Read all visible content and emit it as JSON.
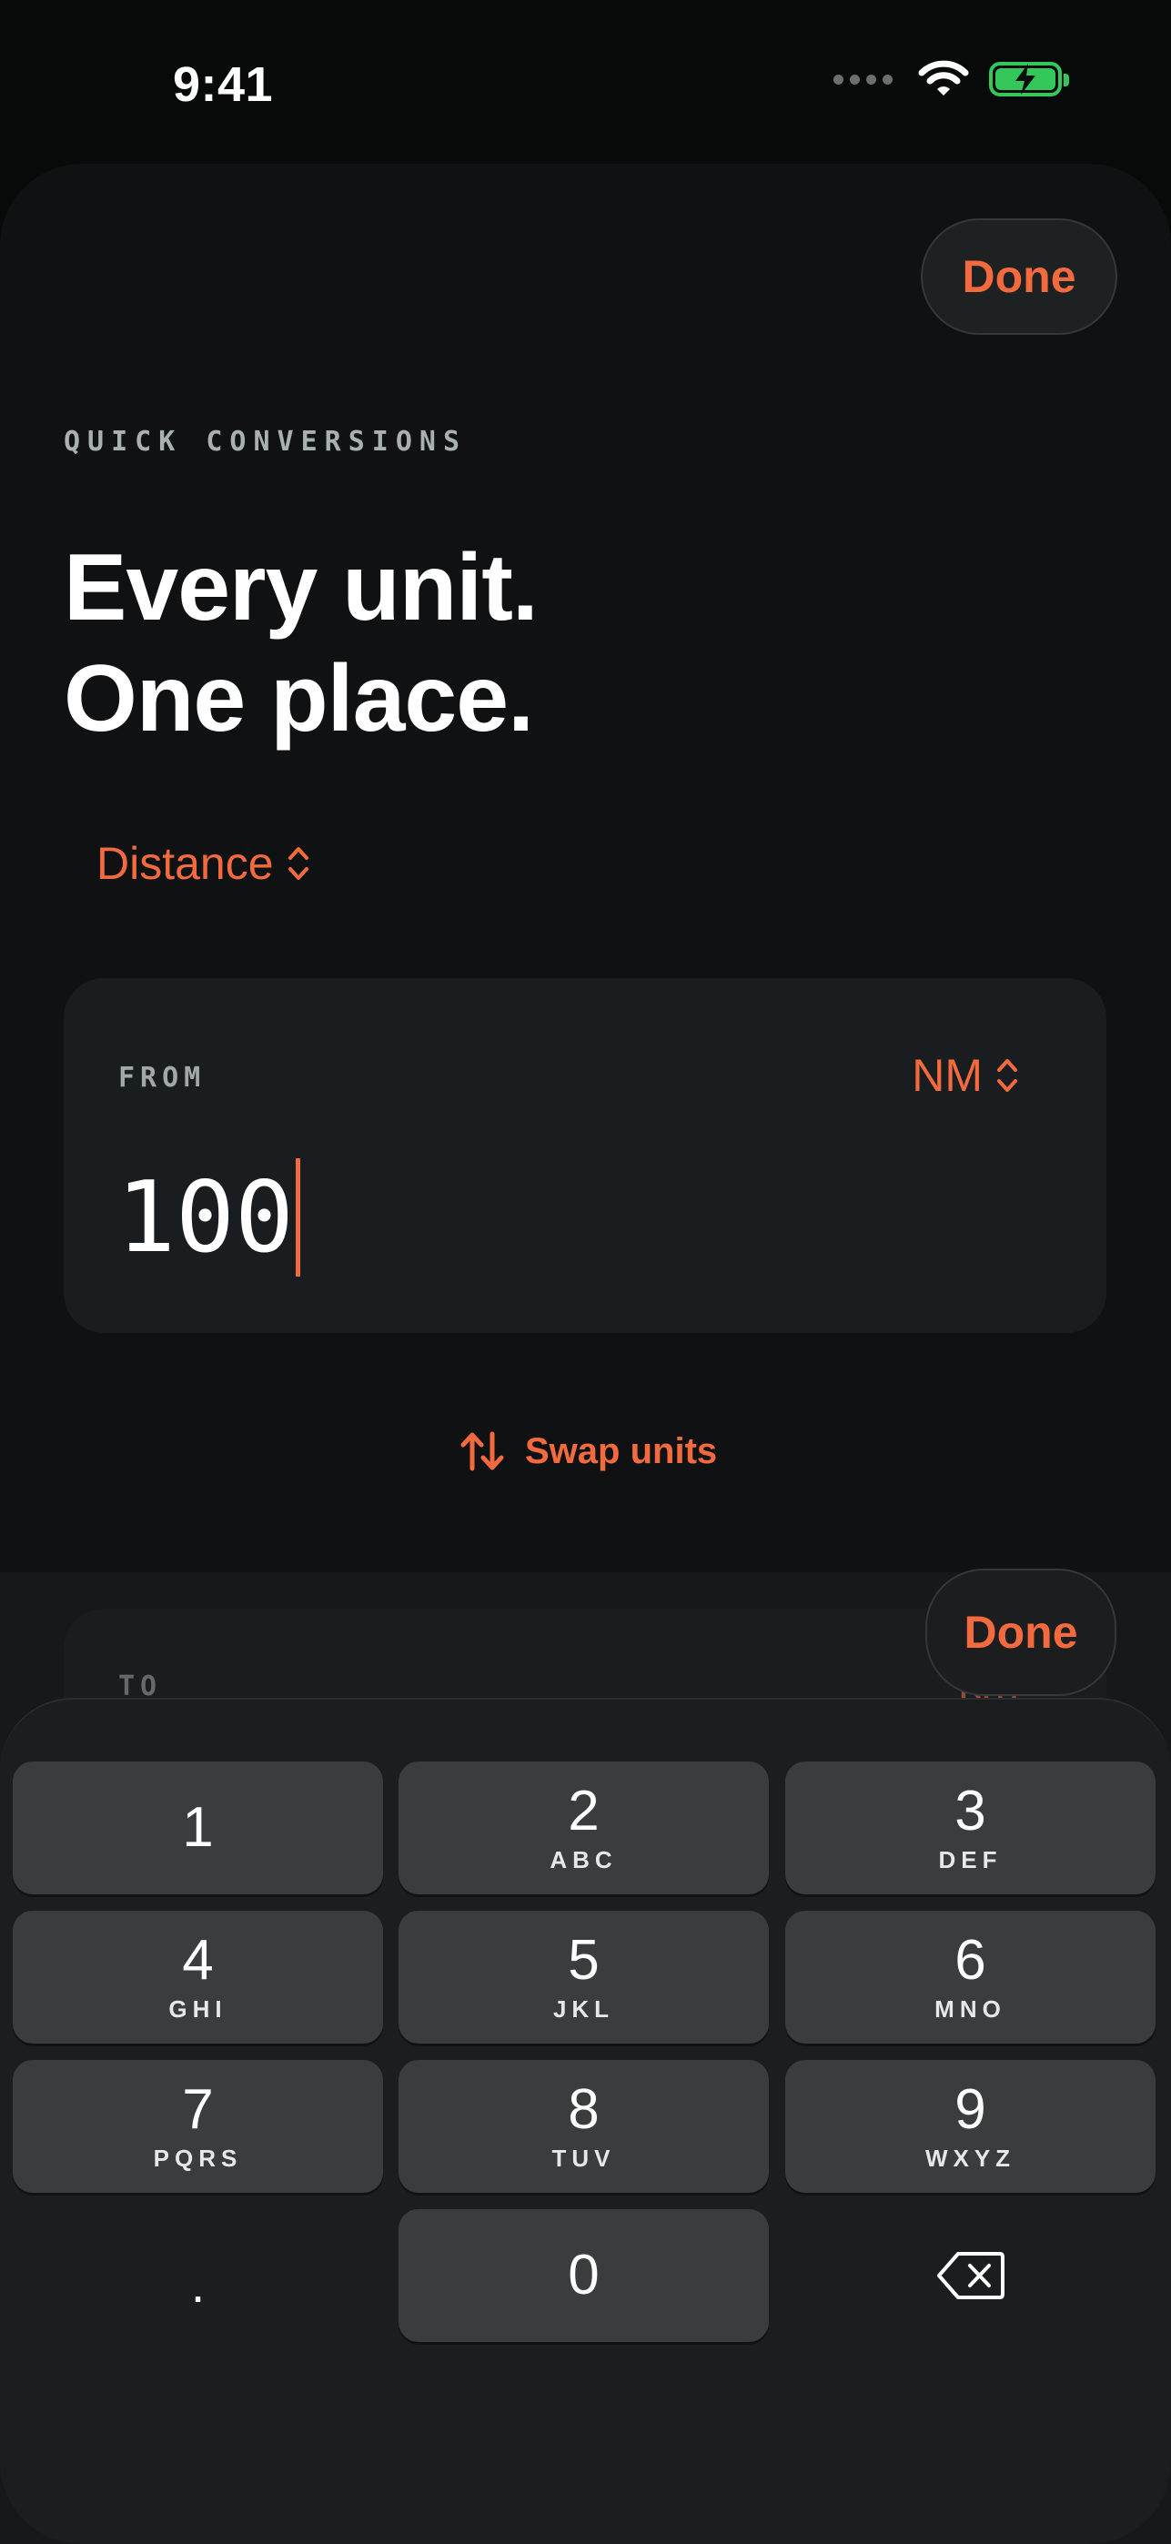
{
  "status_bar": {
    "time": "9:41"
  },
  "header": {
    "done_label": "Done"
  },
  "intro": {
    "eyebrow": "QUICK CONVERSIONS",
    "headline_line1": "Every unit.",
    "headline_line2": "One place."
  },
  "category": {
    "label": "Distance"
  },
  "from_card": {
    "label": "FROM",
    "unit": "NM",
    "value": "100"
  },
  "swap": {
    "label": "Swap units"
  },
  "to_card": {
    "label": "TO",
    "unit": "km"
  },
  "keyboard": {
    "done_label": "Done",
    "keys": [
      {
        "digit": "1",
        "letters": ""
      },
      {
        "digit": "2",
        "letters": "ABC"
      },
      {
        "digit": "3",
        "letters": "DEF"
      },
      {
        "digit": "4",
        "letters": "GHI"
      },
      {
        "digit": "5",
        "letters": "JKL"
      },
      {
        "digit": "6",
        "letters": "MNO"
      },
      {
        "digit": "7",
        "letters": "PQRS"
      },
      {
        "digit": "8",
        "letters": "TUV"
      },
      {
        "digit": "9",
        "letters": "WXYZ"
      },
      {
        "digit": ".",
        "letters": ""
      },
      {
        "digit": "0",
        "letters": ""
      }
    ]
  },
  "colors": {
    "accent": "#f26a3d",
    "battery": "#34c759",
    "background": "#080909"
  }
}
